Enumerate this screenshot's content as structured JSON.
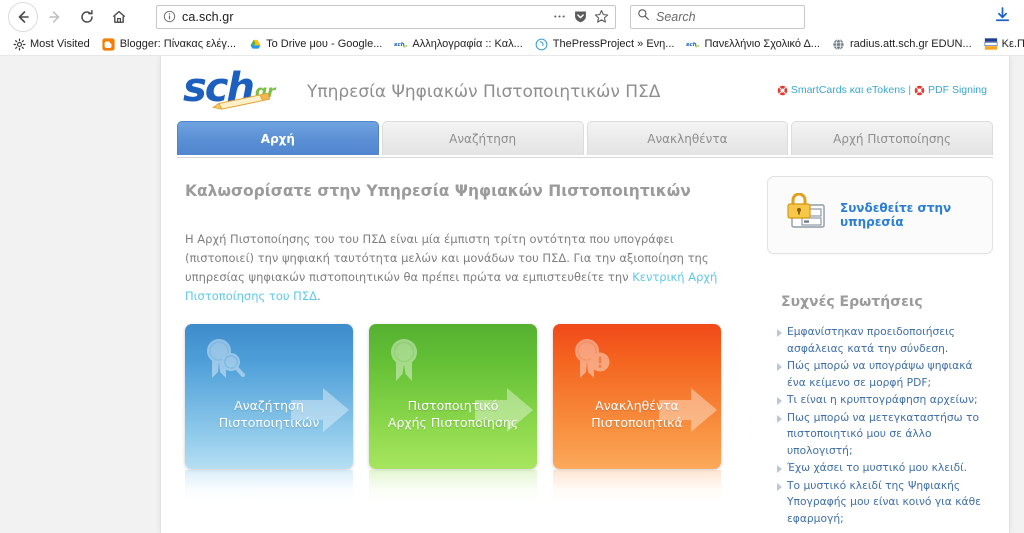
{
  "browser": {
    "nav": {
      "back_icon": "back-arrow-icon",
      "forward_icon": "forward-arrow-icon",
      "reload_icon": "reload-icon",
      "home_icon": "home-icon"
    },
    "urlbar": {
      "identity_icon": "info-circle-icon",
      "url": "ca.sch.gr",
      "page_actions_icon": "ellipsis-icon",
      "pocket_icon": "pocket-shield-icon",
      "bookmark_icon": "star-icon"
    },
    "searchbar": {
      "icon": "magnifier-icon",
      "placeholder": "Search",
      "value": ""
    },
    "downloads": {
      "icon": "download-arrow-icon"
    },
    "bookmarks": [
      {
        "label": "Most Visited",
        "icon": "gear-icon"
      },
      {
        "label": "Blogger: Πίνακας ελέγ...",
        "icon": "blogger-icon"
      },
      {
        "label": "Το Drive μου - Google...",
        "icon": "google-drive-icon"
      },
      {
        "label": "Αλληλογραφία :: Καλ...",
        "icon": "sch-icon"
      },
      {
        "label": "ThePressProject » Ενη...",
        "icon": "thepressproject-icon"
      },
      {
        "label": "Πανελλήνιο Σχολικό Δ...",
        "icon": "sch-icon"
      },
      {
        "label": "radius.att.sch.gr EDUN...",
        "icon": "globe-icon"
      },
      {
        "label": "Κε.Π",
        "icon": "kepliro-icon"
      }
    ]
  },
  "site": {
    "logo": {
      "primary": "sch",
      "suffix": "gr"
    },
    "title": "Υπηρεσία Ψηφιακών Πιστοποιητικών ΠΣΔ",
    "header_links": [
      {
        "label": "SmartCards και eTokens",
        "icon": "lifebuoy-icon"
      },
      {
        "label": "PDF Signing",
        "icon": "lifebuoy-icon"
      }
    ],
    "header_link_separator": "|",
    "tabs": [
      {
        "label": "Αρχή",
        "active": true
      },
      {
        "label": "Αναζήτηση",
        "active": false
      },
      {
        "label": "Ανακληθέντα",
        "active": false
      },
      {
        "label": "Αρχή Πιστοποίησης",
        "active": false
      }
    ],
    "welcome_heading": "Καλωσορίσατε στην Υπηρεσία Ψηφιακών Πιστοποιητικών",
    "intro": {
      "part1": "Η Αρχή Πιστοποίησης του του ΠΣΔ είναι μία έμπιστη τρίτη οντότητα που υπογράφει (πιστοποιεί) την ψηφιακή ταυτότητα μελών και μονάδων του ΠΣΔ. Για την αξιοποίηση της υπηρεσίας ψηφιακών πιστοποιητικών θα πρέπει πρώτα να εμπιστευθείτε την ",
      "link": "Κεντρική Αρχή Πιστοποίησης του ΠΣΔ",
      "part2": "."
    },
    "cards": [
      {
        "line1": "Αναζήτηση",
        "line2": "Πιστοποιητικών",
        "color": "#4d9ed8",
        "theme": "blue",
        "icon": "certificate-search-icon"
      },
      {
        "line1": "Πιστοποιητικό",
        "line2": "Αρχής Πιστοποίησης",
        "color": "#63bf35",
        "theme": "green",
        "icon": "certificate-icon"
      },
      {
        "line1": "Ανακληθέντα",
        "line2": "Πιστοποιητικά",
        "color": "#f4641f",
        "theme": "orange",
        "icon": "certificate-revoked-icon"
      }
    ],
    "login": {
      "icon": "lock-login-icon",
      "label": "Συνδεθείτε στην υπηρεσία"
    },
    "faq": {
      "title": "Συχνές Ερωτήσεις",
      "items": [
        "Εμφανίστηκαν προειδοποιήσεις ασφάλειας κατά την σύνδεση.",
        "Πώς μπορώ να υπογράψω ψηφιακά ένα κείμενο σε μορφή PDF;",
        "Τι είναι η κρυπτογράφηση αρχείων;",
        "Πως μπορώ να μετεγκαταστήσω το πιστοποιητικό μου σε άλλο υπολογιστή;",
        "Έχω χάσει το μυστικό μου κλειδί.",
        "Το μυστικό κλειδί της Ψηφιακής Υπογραφής μου είναι κοινό για κάθε εφαρμογή;"
      ]
    }
  },
  "colors": {
    "accent_blue": "#5a8fd4",
    "link_blue": "#2a7fd4",
    "teal_link": "#5bc8e8",
    "faq_link": "#3f6fa8",
    "header_link": "#3aa6d0"
  }
}
